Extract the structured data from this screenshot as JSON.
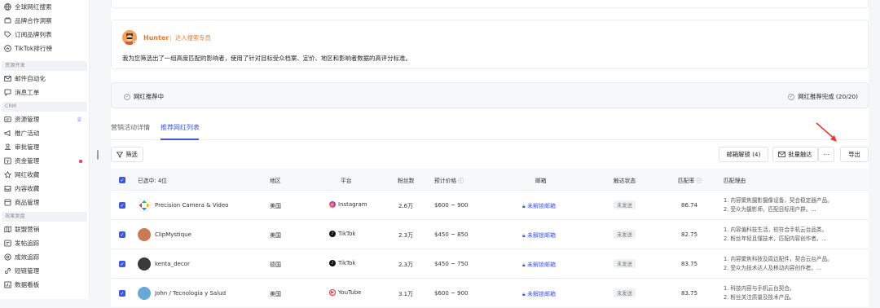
{
  "sidebar": {
    "top_items": [
      {
        "label": "全球网红搜索",
        "icon": "globe-icon"
      },
      {
        "label": "品牌合作洞察",
        "icon": "brand-icon"
      },
      {
        "label": "订阅品牌列表",
        "icon": "tag-icon"
      },
      {
        "label": "TikTok排行榜",
        "icon": "ranking-icon"
      }
    ],
    "groups": [
      {
        "title": "资源开发",
        "items": [
          {
            "label": "邮件自动化",
            "icon": "mail-icon"
          },
          {
            "label": "消息工单",
            "icon": "chat-icon"
          }
        ]
      },
      {
        "title": "CRM",
        "items": [
          {
            "label": "资源管理",
            "icon": "users-icon",
            "badge": "crown"
          },
          {
            "label": "推广活动",
            "icon": "megaphone-icon"
          },
          {
            "label": "审批管理",
            "icon": "stamp-icon"
          },
          {
            "label": "资金管理",
            "icon": "money-icon",
            "badge": "dot"
          },
          {
            "label": "网红收藏",
            "icon": "star-icon"
          },
          {
            "label": "内容收藏",
            "icon": "inbox-icon"
          },
          {
            "label": "商品管理",
            "icon": "box-icon"
          }
        ]
      },
      {
        "title": "效果复盘",
        "items": [
          {
            "label": "联盟营销",
            "icon": "map-icon"
          },
          {
            "label": "发帖追踪",
            "icon": "post-icon"
          },
          {
            "label": "成效追踪",
            "icon": "target-icon"
          },
          {
            "label": "短链管理",
            "icon": "link-icon"
          },
          {
            "label": "数据看板",
            "icon": "dashboard-icon"
          }
        ]
      }
    ]
  },
  "agent": {
    "name": "Hunter",
    "separator": "|",
    "role": "达人搜索专员",
    "message": "我为您筛选出了一组高度匹配的影响者，使用了针对目标受众档案、定价、地区和影响者数据的高评分标准。"
  },
  "progress": {
    "left_label": "网红推荐中",
    "right_label": "网红推荐完成 (20/20)"
  },
  "tabs": [
    {
      "label": "营销活动详情"
    },
    {
      "label": "推荐网红列表",
      "active": true
    }
  ],
  "toolbar": {
    "filter_label": "筛选",
    "unlock_email_label": "邮箱解锁 (4)",
    "bulk_reach_label": "批量触达",
    "more_label": "···",
    "export_label": "导出"
  },
  "table": {
    "headers": {
      "selected": "已选中: 4位",
      "region": "地区",
      "platform": "平台",
      "followers": "粉丝数",
      "price": "预计价格",
      "email": "邮箱",
      "reach_status": "触达状态",
      "match_rate": "匹配率",
      "match_reason": "匹配理由"
    },
    "rows": [
      {
        "name": "Precision Camera & Video",
        "region": "美国",
        "platform": "Instagram",
        "followers": "2.6万",
        "price": "$600 ~ 900",
        "email": "未解锁邮箱",
        "status": "未发送",
        "match": "86.74",
        "reason1": "1. 内容聚焦摄影摄像设备，契合稳定器产品。",
        "reason2": "2. 受众为摄影师，匹配目标用户群。..."
      },
      {
        "name": "ClipMystique",
        "region": "美国",
        "platform": "TikTok",
        "followers": "2.3万",
        "price": "$450 ~ 850",
        "email": "未解锁邮箱",
        "status": "未发送",
        "match": "82.75",
        "reason1": "1. 内容偏科技生活，较符合手机云台品类。",
        "reason2": "2. 粉丝年轻且懂技术，匹配内容创作者。..."
      },
      {
        "name": "kenta_decor",
        "region": "德国",
        "platform": "TikTok",
        "followers": "2.3万",
        "price": "$450 ~ 750",
        "email": "未解锁邮箱",
        "status": "未发送",
        "match": "83.75",
        "reason1": "1. 内容聚焦科技及周边配件，契合云台产品。",
        "reason2": "2. 受众为技术达人及移动内容创作者。..."
      },
      {
        "name": "John / Tecnologia y Salud",
        "region": "美国",
        "platform": "YouTube",
        "followers": "3.1万",
        "price": "$600 ~ 900",
        "email": "未解锁邮箱",
        "status": "未发送",
        "match": "83.75",
        "reason1": "1. 科技内容与手机云台契合。",
        "reason2": "2. 粉丝关注质量及技术产品。"
      }
    ]
  },
  "colors": {
    "accent": "#3f57d9",
    "agent": "#ec7a2a"
  }
}
